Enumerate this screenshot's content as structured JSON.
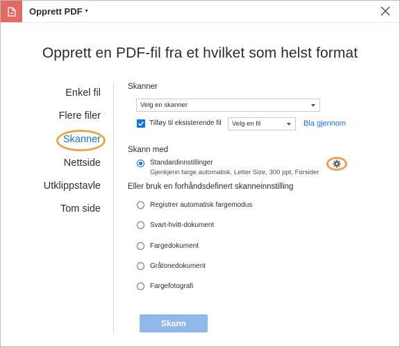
{
  "titlebar": {
    "app_title": "Opprett PDF",
    "caret": "▾"
  },
  "heading": "Opprett en PDF-fil fra et hvilket som helst format",
  "sidebar": {
    "items": [
      {
        "label": "Enkel fil",
        "active": false
      },
      {
        "label": "Flere filer",
        "active": false
      },
      {
        "label": "Skanner",
        "active": true
      },
      {
        "label": "Nettside",
        "active": false
      },
      {
        "label": "Utklippstavle",
        "active": false
      },
      {
        "label": "Tom side",
        "active": false
      }
    ]
  },
  "content": {
    "section_label": "Skanner",
    "scanner_select": "Velg en skanner",
    "append_checkbox_label": "Tilføy til eksisterende fil",
    "append_checked": true,
    "file_select": "Velg en fil",
    "browse_link": "Bla gjennom",
    "scan_with_label": "Skann med",
    "default_option": {
      "label": "Standardinnstillinger",
      "description": "Gjenkjenn farge automatisk, Letter Size, 300 ppt, Forsider",
      "checked": true
    },
    "preset_label": "Eller bruk en forhåndsdefinert skanneinnstilling",
    "presets": [
      {
        "label": "Registrer automatisk fargemodus"
      },
      {
        "label": "Svart-hvitt-dokument"
      },
      {
        "label": "Fargedokument"
      },
      {
        "label": "Gråtonedokument"
      },
      {
        "label": "Fargefotografi"
      }
    ],
    "scan_button": "Skann"
  },
  "colors": {
    "accent": "#1473e6",
    "highlight": "#e8a64a",
    "app_icon": "#e06b65",
    "button_disabled": "#8fb8ea"
  },
  "icons": {
    "app": "acrobat-create-pdf-icon",
    "close": "close-icon",
    "settings": "gear-icon"
  }
}
